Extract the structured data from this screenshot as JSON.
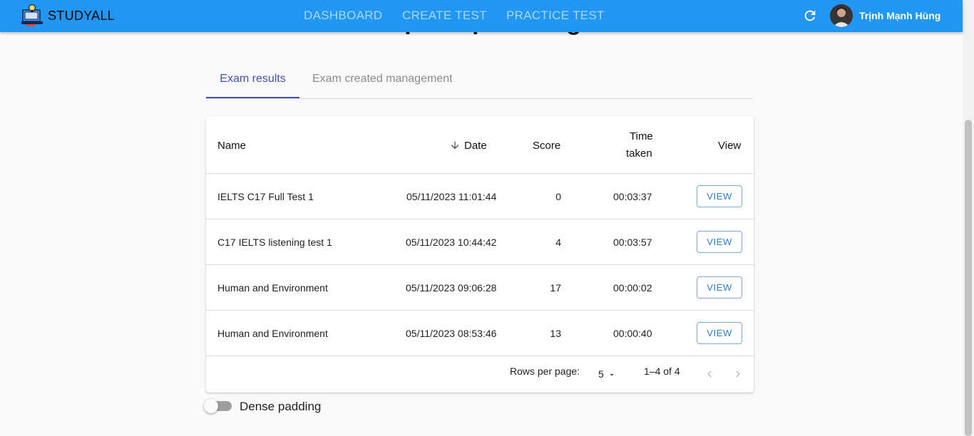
{
  "profile": {
    "name": "Trịnh Mạnh Hùng"
  },
  "appbar": {
    "brand": "STUDYALL",
    "nav": [
      "DASHBOARD",
      "CREATE TEST",
      "PRACTICE TEST"
    ],
    "user_name": "Trịnh Mạnh Hùng",
    "refresh_icon": "refresh-icon",
    "color": "#2196f3"
  },
  "tabs": [
    {
      "label": "Exam results",
      "active": true
    },
    {
      "label": "Exam created management",
      "active": false
    }
  ],
  "table": {
    "columns": {
      "name": "Name",
      "date": "Date",
      "score": "Score",
      "time_line1": "Time",
      "time_line2": "taken",
      "view": "View"
    },
    "sort_icon": "arrow-down-icon",
    "rows": [
      {
        "name": "IELTS C17 Full Test 1",
        "date": "05/11/2023 11:01:44",
        "score": "0",
        "time": "00:03:37",
        "action": "VIEW"
      },
      {
        "name": "C17 IELTS listening test 1",
        "date": "05/11/2023 10:44:42",
        "score": "4",
        "time": "00:03:57",
        "action": "VIEW"
      },
      {
        "name": "Human and Environment",
        "date": "05/11/2023 09:06:28",
        "score": "17",
        "time": "00:00:02",
        "action": "VIEW"
      },
      {
        "name": "Human and Environment",
        "date": "05/11/2023 08:53:46",
        "score": "13",
        "time": "00:00:40",
        "action": "VIEW"
      }
    ]
  },
  "pagination": {
    "rows_per_page_label": "Rows per page:",
    "rows_per_page_value": "5",
    "range": "1–4 of 4"
  },
  "dense_padding": {
    "label": "Dense padding",
    "enabled": false
  }
}
